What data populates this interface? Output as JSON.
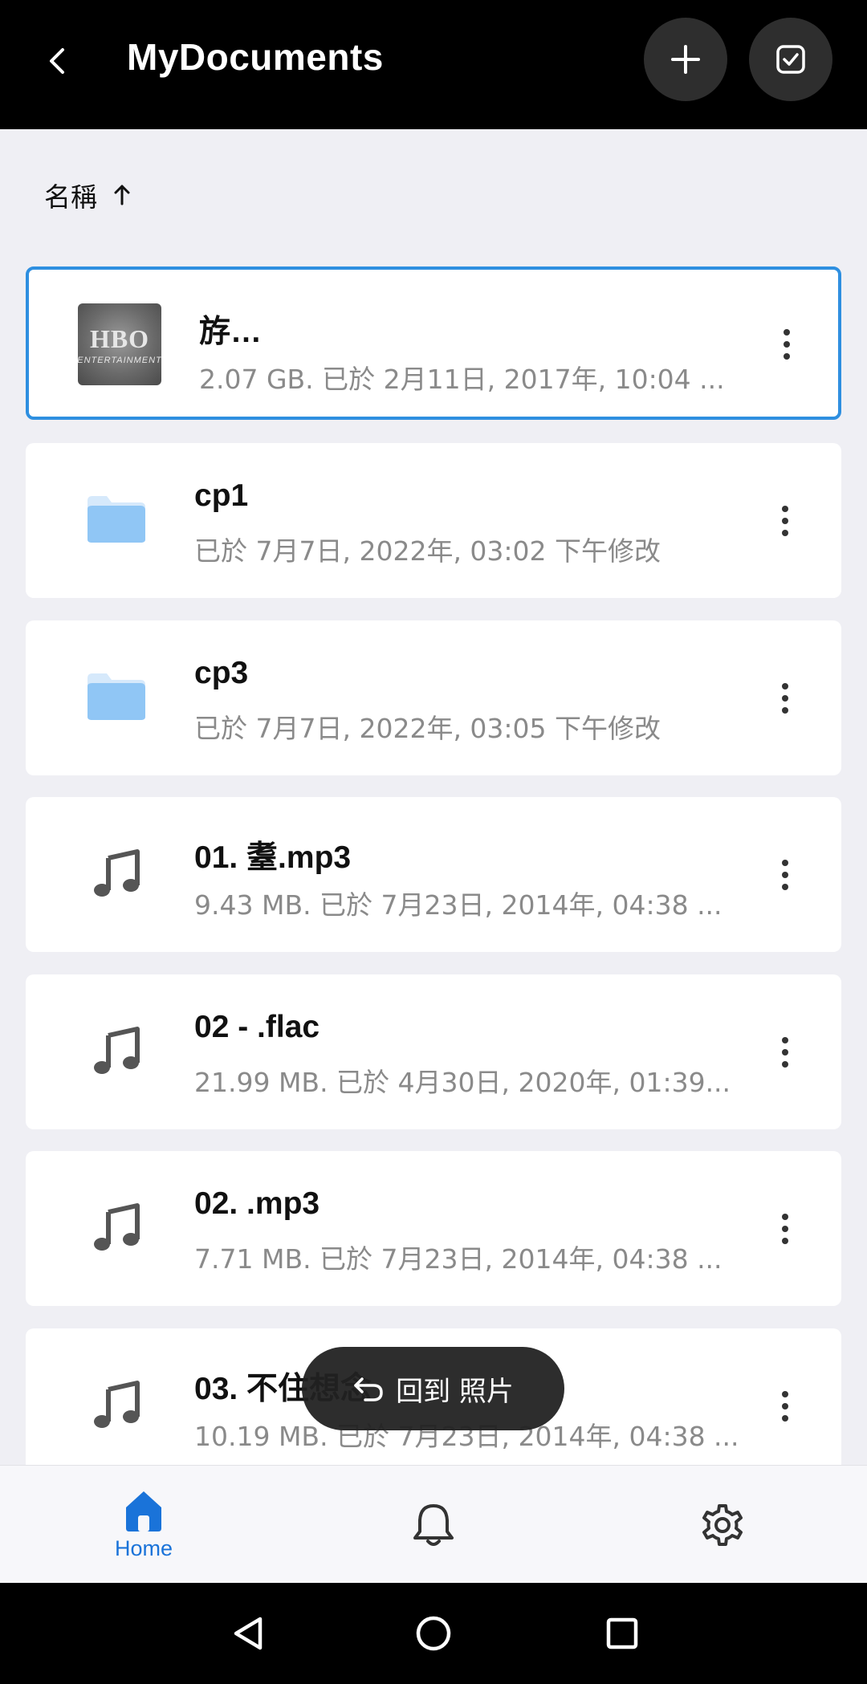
{
  "header": {
    "title": "MyDocuments",
    "back_icon": "chevron-left-icon",
    "add_icon": "plus-icon",
    "select_icon": "checkbox-icon"
  },
  "sort": {
    "label": "名稱",
    "direction_icon": "arrow-up-icon"
  },
  "items": [
    {
      "name": "                    斿…",
      "meta": "2.07 GB. 已於 2月11日, 2017年, 10:04 ...",
      "kind": "video-thumbnail",
      "thumb_logo": "HBO",
      "thumb_sub": "ENTERTAINMENT",
      "selected": true
    },
    {
      "name": "cp1",
      "meta": "已於 7月7日, 2022年, 03:02 下午修改",
      "kind": "folder"
    },
    {
      "name": "cp3",
      "meta": "已於 7月7日, 2022年, 03:05 下午修改",
      "kind": "folder"
    },
    {
      "name": "01.         耋.mp3",
      "meta": "9.43 MB. 已於 7月23日, 2014年, 04:38 ...",
      "kind": "audio"
    },
    {
      "name": "02 -     .flac",
      "meta": "21.99 MB. 已於 4月30日, 2020年, 01:39...",
      "kind": "audio"
    },
    {
      "name": "02.     .mp3",
      "meta": "7.71 MB. 已於 7月23日, 2014年, 04:38 ...",
      "kind": "audio"
    },
    {
      "name": "03.      不住想念",
      "meta": "10.19 MB. 已於 7月23日, 2014年, 04:38 ...",
      "kind": "audio"
    }
  ],
  "toast": {
    "label": "回到 照片",
    "icon": "undo-arrow-icon"
  },
  "bottom_nav": {
    "home_label": "Home",
    "active": "home"
  },
  "colors": {
    "accent": "#1a73d9",
    "selected_border": "#2e8fe0",
    "folder": "#90c6f5",
    "header_bg": "#000000",
    "list_bg": "#efeff4"
  }
}
